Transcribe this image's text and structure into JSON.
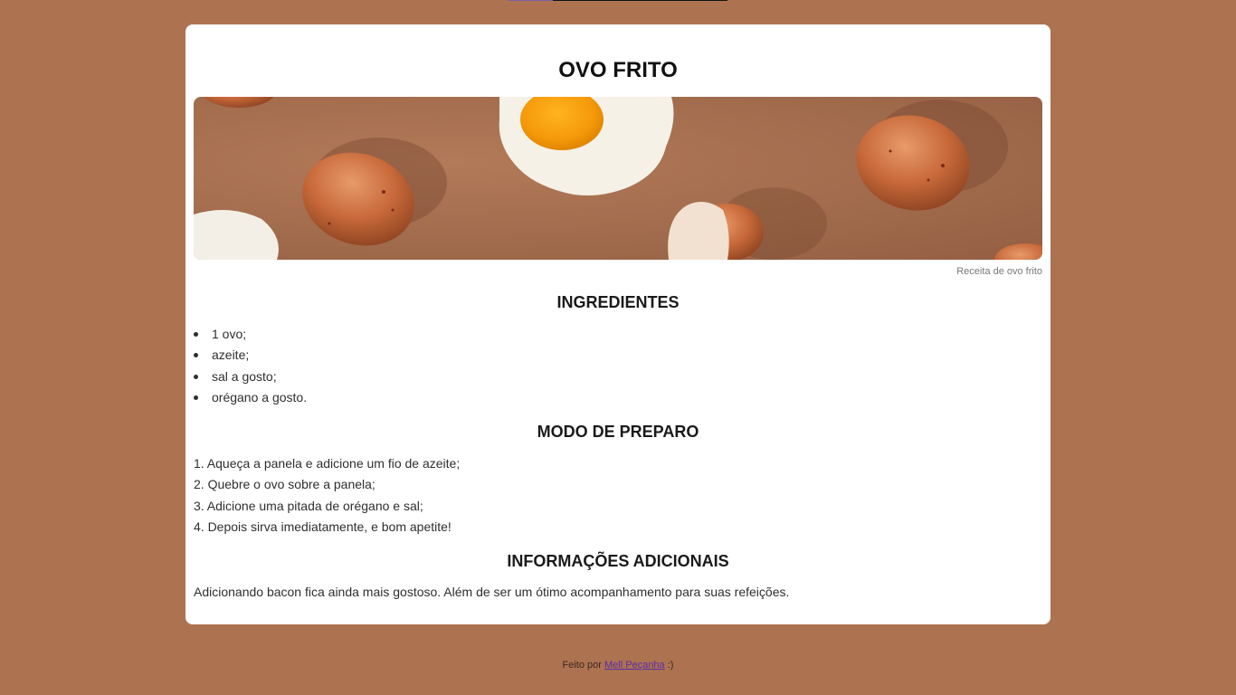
{
  "recipe": {
    "title": "OVO FRITO",
    "image_caption": "Receita de ovo frito",
    "ingredients_heading": "INGREDIENTES",
    "ingredients": [
      "1 ovo;",
      "azeite;",
      "sal a gosto;",
      "orégano a gosto."
    ],
    "steps_heading": "MODO DE PREPARO",
    "steps": [
      "1. Aqueça a panela e adicione um fio de azeite;",
      "2. Quebre o ovo sobre a panela;",
      "3. Adicione uma pitada de orégano e sal;",
      "4. Depois sirva imediatamente, e bom apetite!"
    ],
    "info_heading": "INFORMAÇÕES ADICIONAIS",
    "info_text": "Adicionando bacon fica ainda mais gostoso. Além de ser um ótimo acompanhamento para suas refeições."
  },
  "footer": {
    "prefix": "Feito por",
    "author_link": "Mell Peçanha",
    "suffix": ":)"
  },
  "colors": {
    "background": "#ad7250",
    "card": "#ffffff",
    "link": "#5a2fa8"
  }
}
